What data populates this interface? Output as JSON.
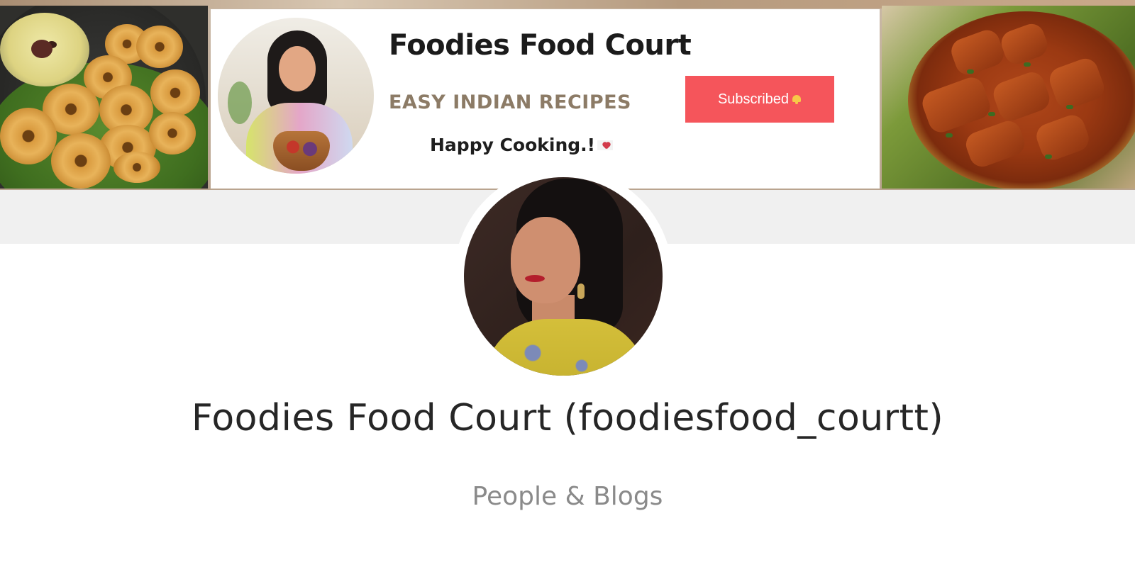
{
  "banner": {
    "title": "Foodies Food Court",
    "tagline": "EASY INDIAN RECIPES",
    "motto": "Happy Cooking.!",
    "subscribe_label": "Subscribed"
  },
  "profile": {
    "name": "Foodies Food Court (foodiesfood_courtt)",
    "category": "People & Blogs"
  },
  "icons": [
    "heart-icon",
    "bell-icon"
  ],
  "colors": {
    "subscribe_button": "#f5555b",
    "tagline": "#8c7b66",
    "name_text": "#262626",
    "category_text": "#8a8a8a",
    "band": "#f0f0f0"
  }
}
